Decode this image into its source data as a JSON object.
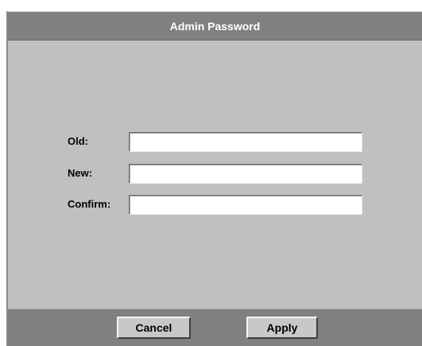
{
  "dialog": {
    "title": "Admin Password"
  },
  "form": {
    "old_label": "Old:",
    "old_value": "",
    "new_label": "New:",
    "new_value": "",
    "confirm_label": "Confirm:",
    "confirm_value": ""
  },
  "buttons": {
    "cancel": "Cancel",
    "apply": "Apply"
  },
  "colors": {
    "titlebar": "#808080",
    "dialog_bg": "#c0c0c0",
    "field_bg": "#ffffff",
    "title_text": "#ffffff"
  }
}
